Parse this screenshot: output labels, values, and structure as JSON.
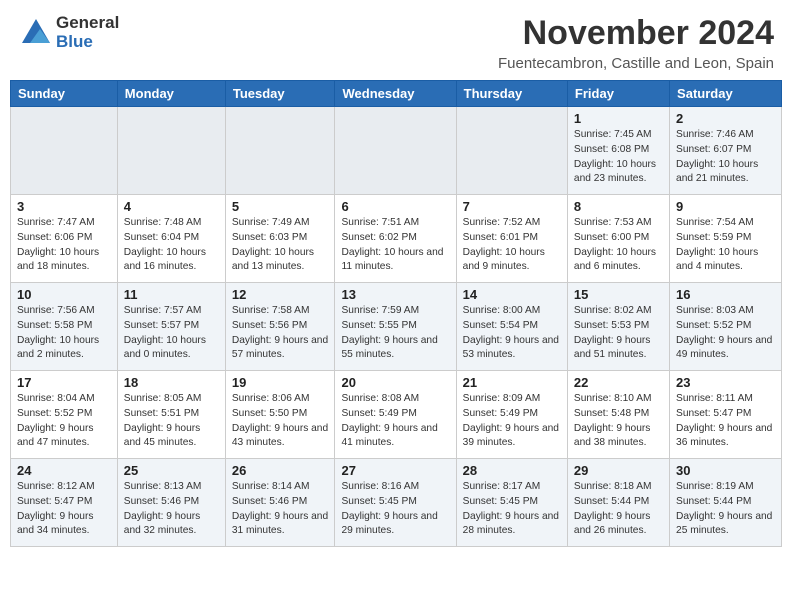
{
  "header": {
    "logo_general": "General",
    "logo_blue": "Blue",
    "month_title": "November 2024",
    "location": "Fuentecambron, Castille and Leon, Spain"
  },
  "weekdays": [
    "Sunday",
    "Monday",
    "Tuesday",
    "Wednesday",
    "Thursday",
    "Friday",
    "Saturday"
  ],
  "weeks": [
    [
      {
        "day": "",
        "info": ""
      },
      {
        "day": "",
        "info": ""
      },
      {
        "day": "",
        "info": ""
      },
      {
        "day": "",
        "info": ""
      },
      {
        "day": "",
        "info": ""
      },
      {
        "day": "1",
        "info": "Sunrise: 7:45 AM\nSunset: 6:08 PM\nDaylight: 10 hours and 23 minutes."
      },
      {
        "day": "2",
        "info": "Sunrise: 7:46 AM\nSunset: 6:07 PM\nDaylight: 10 hours and 21 minutes."
      }
    ],
    [
      {
        "day": "3",
        "info": "Sunrise: 7:47 AM\nSunset: 6:06 PM\nDaylight: 10 hours and 18 minutes."
      },
      {
        "day": "4",
        "info": "Sunrise: 7:48 AM\nSunset: 6:04 PM\nDaylight: 10 hours and 16 minutes."
      },
      {
        "day": "5",
        "info": "Sunrise: 7:49 AM\nSunset: 6:03 PM\nDaylight: 10 hours and 13 minutes."
      },
      {
        "day": "6",
        "info": "Sunrise: 7:51 AM\nSunset: 6:02 PM\nDaylight: 10 hours and 11 minutes."
      },
      {
        "day": "7",
        "info": "Sunrise: 7:52 AM\nSunset: 6:01 PM\nDaylight: 10 hours and 9 minutes."
      },
      {
        "day": "8",
        "info": "Sunrise: 7:53 AM\nSunset: 6:00 PM\nDaylight: 10 hours and 6 minutes."
      },
      {
        "day": "9",
        "info": "Sunrise: 7:54 AM\nSunset: 5:59 PM\nDaylight: 10 hours and 4 minutes."
      }
    ],
    [
      {
        "day": "10",
        "info": "Sunrise: 7:56 AM\nSunset: 5:58 PM\nDaylight: 10 hours and 2 minutes."
      },
      {
        "day": "11",
        "info": "Sunrise: 7:57 AM\nSunset: 5:57 PM\nDaylight: 10 hours and 0 minutes."
      },
      {
        "day": "12",
        "info": "Sunrise: 7:58 AM\nSunset: 5:56 PM\nDaylight: 9 hours and 57 minutes."
      },
      {
        "day": "13",
        "info": "Sunrise: 7:59 AM\nSunset: 5:55 PM\nDaylight: 9 hours and 55 minutes."
      },
      {
        "day": "14",
        "info": "Sunrise: 8:00 AM\nSunset: 5:54 PM\nDaylight: 9 hours and 53 minutes."
      },
      {
        "day": "15",
        "info": "Sunrise: 8:02 AM\nSunset: 5:53 PM\nDaylight: 9 hours and 51 minutes."
      },
      {
        "day": "16",
        "info": "Sunrise: 8:03 AM\nSunset: 5:52 PM\nDaylight: 9 hours and 49 minutes."
      }
    ],
    [
      {
        "day": "17",
        "info": "Sunrise: 8:04 AM\nSunset: 5:52 PM\nDaylight: 9 hours and 47 minutes."
      },
      {
        "day": "18",
        "info": "Sunrise: 8:05 AM\nSunset: 5:51 PM\nDaylight: 9 hours and 45 minutes."
      },
      {
        "day": "19",
        "info": "Sunrise: 8:06 AM\nSunset: 5:50 PM\nDaylight: 9 hours and 43 minutes."
      },
      {
        "day": "20",
        "info": "Sunrise: 8:08 AM\nSunset: 5:49 PM\nDaylight: 9 hours and 41 minutes."
      },
      {
        "day": "21",
        "info": "Sunrise: 8:09 AM\nSunset: 5:49 PM\nDaylight: 9 hours and 39 minutes."
      },
      {
        "day": "22",
        "info": "Sunrise: 8:10 AM\nSunset: 5:48 PM\nDaylight: 9 hours and 38 minutes."
      },
      {
        "day": "23",
        "info": "Sunrise: 8:11 AM\nSunset: 5:47 PM\nDaylight: 9 hours and 36 minutes."
      }
    ],
    [
      {
        "day": "24",
        "info": "Sunrise: 8:12 AM\nSunset: 5:47 PM\nDaylight: 9 hours and 34 minutes."
      },
      {
        "day": "25",
        "info": "Sunrise: 8:13 AM\nSunset: 5:46 PM\nDaylight: 9 hours and 32 minutes."
      },
      {
        "day": "26",
        "info": "Sunrise: 8:14 AM\nSunset: 5:46 PM\nDaylight: 9 hours and 31 minutes."
      },
      {
        "day": "27",
        "info": "Sunrise: 8:16 AM\nSunset: 5:45 PM\nDaylight: 9 hours and 29 minutes."
      },
      {
        "day": "28",
        "info": "Sunrise: 8:17 AM\nSunset: 5:45 PM\nDaylight: 9 hours and 28 minutes."
      },
      {
        "day": "29",
        "info": "Sunrise: 8:18 AM\nSunset: 5:44 PM\nDaylight: 9 hours and 26 minutes."
      },
      {
        "day": "30",
        "info": "Sunrise: 8:19 AM\nSunset: 5:44 PM\nDaylight: 9 hours and 25 minutes."
      }
    ]
  ]
}
